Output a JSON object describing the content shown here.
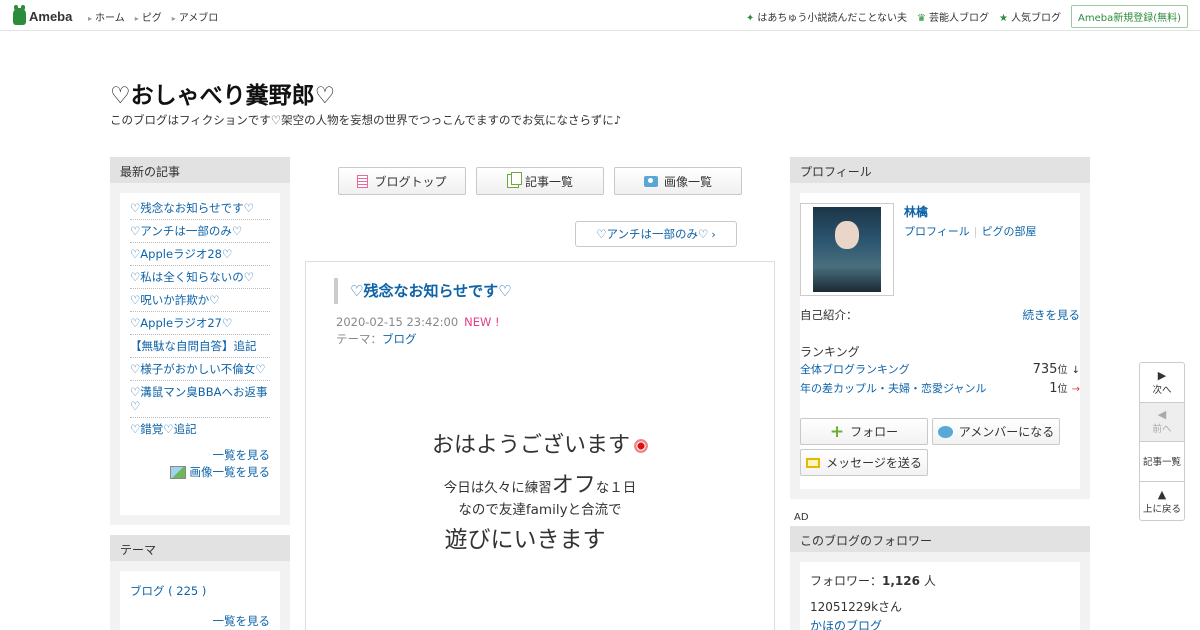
{
  "header": {
    "logo_text": "Ameba",
    "nav": [
      "ホーム",
      "ピグ",
      "アメブロ"
    ],
    "right_links": [
      {
        "icon": "sparkle-icon",
        "label": "はあちゅう小説読んだことない夫"
      },
      {
        "icon": "crown-icon",
        "label": "芸能人ブログ"
      },
      {
        "icon": "star-icon",
        "label": "人気ブログ"
      }
    ],
    "signup_label": "Ameba新規登録(無料)"
  },
  "blog": {
    "title": "♡おしゃべり糞野郎♡",
    "description": "このブログはフィクションです♡架空の人物を妄想の世界でつっこんでますのでお気になさらずに♪"
  },
  "recent": {
    "heading": "最新の記事",
    "items": [
      "♡残念なお知らせです♡",
      "♡アンチは一部のみ♡",
      "♡Appleラジオ28♡",
      "♡私は全く知らないの♡",
      "♡呪いか詐欺か♡",
      "♡Appleラジオ27♡",
      "【無駄な自問自答】追記",
      "♡様子がおかしい不倫女♡",
      "♡溝鼠マン臭BBAへお返事♡",
      "♡錯覚♡追記"
    ],
    "more_label": "一覧を見る",
    "image_list_label": "画像一覧を見る"
  },
  "theme": {
    "heading": "テーマ",
    "items": [
      "ブログ ( 225 )"
    ],
    "more_label": "一覧を見る"
  },
  "main_nav": {
    "top_label": "ブログトップ",
    "list_label": "記事一覧",
    "images_label": "画像一覧"
  },
  "pager": {
    "next_label": "♡アンチは一部のみ♡"
  },
  "article": {
    "title": "♡残念なお知らせです♡",
    "date": "2020-02-15 23:42:00",
    "new_badge": "NEW !",
    "theme_label": "テーマ：",
    "theme_value": "ブログ",
    "body_line1": "おはようございます",
    "body_line2_a": "今日は久々に練習",
    "body_line2_b": "オフ",
    "body_line2_c": "な１日",
    "body_line3": "なので友達familyと合流で",
    "body_line4": "遊びにいきます"
  },
  "profile": {
    "heading": "プロフィール",
    "name": "林檎",
    "profile_link": "プロフィール",
    "pigg_link": "ピグの部屋",
    "intro_label": "自己紹介：",
    "intro_more": "続きを見る",
    "ranking_label": "ランキング",
    "rankings": [
      {
        "label": "全体ブログランキング",
        "value": "735",
        "unit": "位",
        "trend": "↓"
      },
      {
        "label": "年の差カップル・夫婦・恋愛ジャンル",
        "value": "1",
        "unit": "位",
        "trend": "→"
      }
    ],
    "follow_label": "フォロー",
    "amember_label": "アメンバーになる",
    "message_label": "メッセージを送る"
  },
  "ad_label": "AD",
  "followers": {
    "heading": "このブログのフォロワー",
    "count_label": "フォロワー：",
    "count": "1,126",
    "count_unit": "人",
    "sample_name": "12051229kさん",
    "sample_blog": "かほのブログ"
  },
  "float_nav": {
    "next": "次へ",
    "prev": "前へ",
    "list": "記事一覧",
    "top": "上に戻る"
  }
}
